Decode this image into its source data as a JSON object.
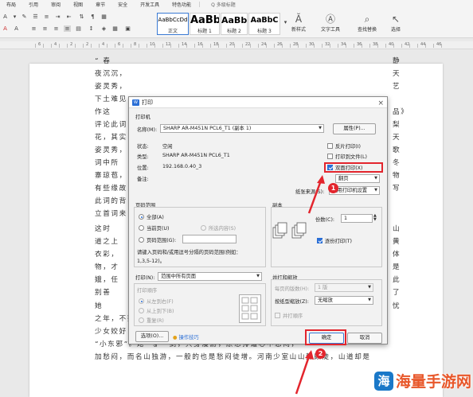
{
  "menu": [
    "布局",
    "引用",
    "审阅",
    "视图",
    "章节",
    "安全",
    "开发工具",
    "特色功能"
  ],
  "search_placeholder": "Q 多级标题",
  "styles": [
    {
      "sample": "AaBbCcDd",
      "label": "正文"
    },
    {
      "sample": "AaBb",
      "label": "标题 1"
    },
    {
      "sample": "AaBb(",
      "label": "标题 2"
    },
    {
      "sample": "AaBbC",
      "label": "标题 3"
    }
  ],
  "ribbon_tools": [
    "新样式",
    "文字工具",
    "查找替换",
    "选择"
  ],
  "ruler_numbers": [
    "6",
    "4",
    "2",
    "2",
    "4",
    "6",
    "8",
    "10",
    "12",
    "14",
    "16",
    "18",
    "20",
    "22",
    "24",
    "26",
    "28",
    "30",
    "32",
    "34",
    "36",
    "38",
    "40",
    "42",
    "44",
    "46"
  ],
  "document_lines": [
    {
      "left": "“  春",
      "right": "静"
    },
    {
      "left": "夜沉沉，",
      "right": "天"
    },
    {
      "left": "姿灵秀，",
      "right": "艺"
    },
    {
      "left": "下土难见",
      "right": ""
    },
    {
      "left": "    作这",
      "right": "品》"
    },
    {
      "left": "评论此词",
      "right": "梨"
    },
    {
      "left": "花，其实",
      "right": "天"
    },
    {
      "left": "姿灵秀，",
      "right": "歌"
    },
    {
      "left": "词中所",
      "right": "冬"
    },
    {
      "left": "寨琼苞，",
      "right": "物"
    },
    {
      "left": "有些缘故",
      "right": "写"
    },
    {
      "left": "此词的背",
      "right": ""
    },
    {
      "left": "立首词来",
      "right": ""
    },
    {
      "left": "    这时",
      "right": "山"
    },
    {
      "left": "道之上",
      "right": "黄"
    },
    {
      "left": "衣彩，",
      "right": "体"
    },
    {
      "left": "物，才",
      "right": "是"
    },
    {
      "left": "娥，任",
      "right": "此"
    },
    {
      "left": "别善",
      "right": "了"
    },
    {
      "left": "    她",
      "right": "忧"
    },
    {
      "left": "之年，不要受金同初他伤有惯内容。似是恐总谈人，那定一一九井由一天世，",
      "right": ""
    },
    {
      "left": "少女姣好，单一个嘉芳，乃大长郭大女儿的次女，有个外号叫做",
      "right": ""
    },
    {
      "left": "“小东邪”。她一驴一剑，只身漫游，原想排遣心中愁闷，",
      "right": ""
    },
    {
      "left": "加愁闷，而名山独游，一般的也是愁闷徒增。河南少室山山势颇陡，山道却是",
      "right": ""
    }
  ],
  "dialog": {
    "title": "打印",
    "printer_section": "打印机",
    "name_label": "名称(M):",
    "printer_name": "SHARP AR-M451N PCL6_T1 (副本 1)",
    "properties_button": "属性(P)...",
    "status_label": "状态:",
    "status_value": "空闲",
    "type_label": "类型:",
    "type_value": "SHARP AR-M451N PCL6_T1",
    "location_label": "位置:",
    "location_value": "192.168.0.40_3",
    "comment_label": "备注:",
    "reverse_print": "反片打印(I)",
    "print_to_file": "打印到文件(L)",
    "duplex_print": "双面打印(X)",
    "duplex_mode": "翻页",
    "paper_source_label": "纸张来源(S):",
    "paper_source_value": "使用打印机设置",
    "page_range_title": "页码范围",
    "range_all": "全部(A)",
    "range_current": "当前页(U)",
    "range_selection": "所选内容(S)",
    "range_pages": "页码范围(G):",
    "range_hint_1": "请键入页码和/或用逗号分隔的页码范围(例如：",
    "range_hint_2": "1,3,5-12)。",
    "copies_title": "副本",
    "copies_label": "份数(C):",
    "copies_value": "1",
    "collate": "逐份打印(T)",
    "print_label": "打印(N):",
    "print_value": "范围中所有页面",
    "print_order_label": "打印顺序",
    "order_left_right": "从左到右(F)",
    "order_top_bottom": "从上到下(B)",
    "order_repeat": "重复(R)",
    "scale_title": "并打和缩放",
    "pages_per_sheet_label": "每页的版数(H):",
    "pages_per_sheet_value": "1 版",
    "scale_label": "按纸型缩放(Z):",
    "scale_value": "无缩放",
    "scale_order": "并打顺序",
    "options_button": "选项(O)...",
    "tips_link": "操作技巧",
    "ok_button": "确定",
    "cancel_button": "取消",
    "callout_1": "1",
    "callout_2": "2"
  },
  "watermark": {
    "logo": "海",
    "text": "海量手游网"
  },
  "colors": {
    "highlight": "#e3252d",
    "accent": "#2b6fd6"
  }
}
